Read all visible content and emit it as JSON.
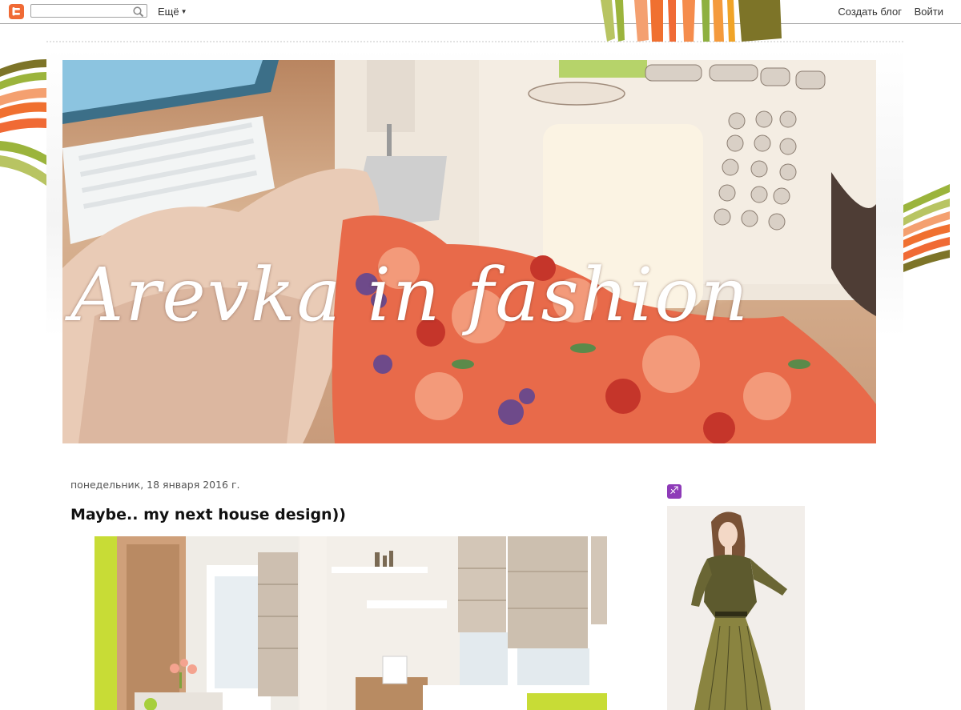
{
  "navbar": {
    "search_placeholder": "",
    "more_label": "Ещё",
    "create_blog_label": "Создать блог",
    "login_label": "Войти"
  },
  "header": {
    "title": "Arevka in fashion"
  },
  "post": {
    "date": "понедельник, 18 января 2016 г.",
    "title": "Maybe.. my next house design))"
  },
  "sidebar": {
    "zodiac_glyph": "♐"
  },
  "icons": {
    "blogger": "blogger-logo-icon",
    "search": "search-icon",
    "zodiac": "sagittarius-icon"
  },
  "colors": {
    "blogger_orange": "#f06a35",
    "stripe_green": "#9bb43c",
    "stripe_orange": "#f07030",
    "stripe_olive": "#7d7428",
    "zodiac_purple": "#8e3bb8"
  }
}
